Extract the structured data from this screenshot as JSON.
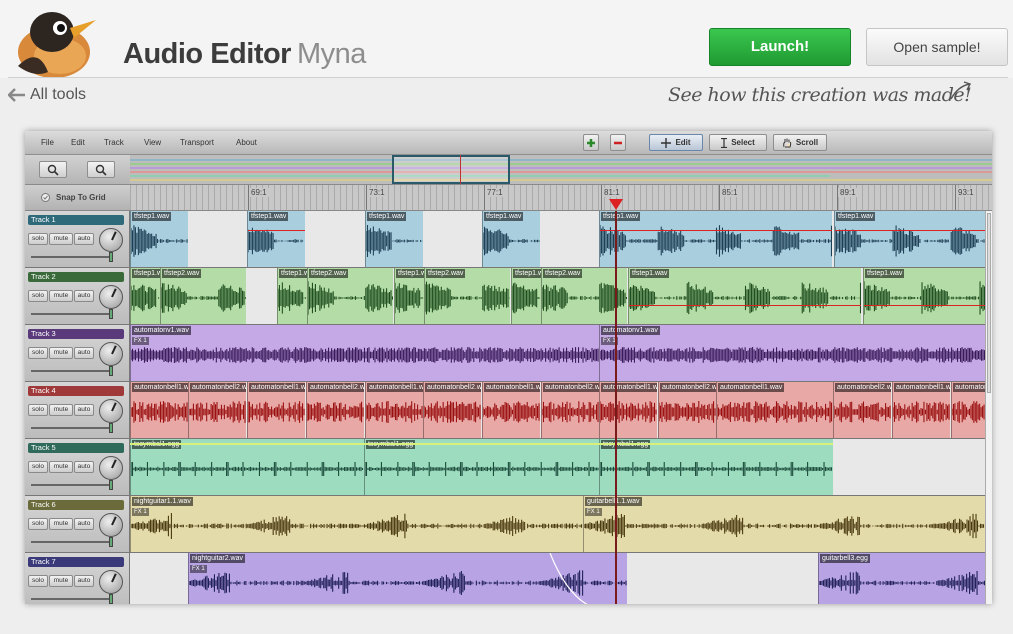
{
  "header": {
    "title": "Audio Editor",
    "subtitle": "Myna",
    "launch_label": "Launch!",
    "open_sample_label": "Open sample!",
    "all_tools_label": "All tools",
    "see_how_label": "See how this creation was made!"
  },
  "editor": {
    "menu": [
      "File",
      "Edit",
      "Track",
      "View",
      "Transport",
      "About"
    ],
    "tools": {
      "edit": "Edit",
      "select": "Select",
      "scroll": "Scroll"
    },
    "snap_label": "Snap To Grid",
    "ruler_labels": [
      "69:1",
      "73:1",
      "77:1",
      "81:1",
      "85:1",
      "89:1",
      "93:1"
    ],
    "track_buttons": {
      "solo": "solo",
      "mute": "mute",
      "auto": "auto"
    },
    "tracks": [
      {
        "name": "Track 1",
        "color": "#2f6a7a",
        "clip_color": "#a9cfdf",
        "wave_color": "#1f3f55",
        "clips": [
          {
            "label": "tfstep1.wav"
          },
          {
            "label": "tfstep1.wav"
          },
          {
            "label": "tfstep1.wav"
          },
          {
            "label": "tfstep1.wav"
          },
          {
            "label": "tfstep1.wav"
          },
          {
            "label": "tfstep1.wav"
          }
        ]
      },
      {
        "name": "Track 2",
        "color": "#3a6a3a",
        "clip_color": "#b4dca6",
        "wave_color": "#1f4f1f",
        "clips": [
          {
            "label": "tfstep1.wav"
          },
          {
            "label": "tfstep2.wav"
          },
          {
            "label": "tfstep1.wav"
          },
          {
            "label": "tfstep2.wav"
          },
          {
            "label": "tfstep1.wav"
          },
          {
            "label": "tfstep2.wav"
          },
          {
            "label": "tfstep1.wav"
          },
          {
            "label": "tfstep2.wav"
          },
          {
            "label": "tfstep1.wav"
          },
          {
            "label": "tfstep1.wav"
          }
        ]
      },
      {
        "name": "Track 3",
        "color": "#5a3a7a",
        "clip_color": "#c5a8e6",
        "wave_color": "#3a1a5a",
        "clips": [
          {
            "label": "automatonv1.wav",
            "fx": "FX 1"
          },
          {
            "label": "automatonv1.wav",
            "fx": "FX 1"
          }
        ]
      },
      {
        "name": "Track 4",
        "color": "#a03a3a",
        "clip_color": "#e8a8a6",
        "wave_color": "#9a1010",
        "clips": [
          {
            "label": "automatonbell1.wav"
          },
          {
            "label": "automatonbell2.wav"
          },
          {
            "label": "automatonbell1.wav"
          },
          {
            "label": "automatonbell2.wav"
          },
          {
            "label": "automatonbell1.wav"
          },
          {
            "label": "automatonbell2.wav"
          },
          {
            "label": "automatonbell1.wav"
          },
          {
            "label": "automatonbell2.wav"
          },
          {
            "label": "automatonbell1.wav"
          },
          {
            "label": "automatonbell2.wav"
          },
          {
            "label": "automatonbell1.wav"
          },
          {
            "label": "automatonbell2.wav"
          },
          {
            "label": "automatonbell1.wav"
          },
          {
            "label": "automatonbell2.wav"
          },
          {
            "label": "automatonbell1.wav"
          }
        ]
      },
      {
        "name": "Track 5",
        "color": "#2f6a5a",
        "clip_color": "#9edcc0",
        "wave_color": "#1a4a3a",
        "clips": [
          {
            "label": "tscymbal1.egg"
          },
          {
            "label": "tscymbal1.egg"
          },
          {
            "label": "tscymbal1.egg"
          }
        ]
      },
      {
        "name": "Track 6",
        "color": "#6a6a3a",
        "clip_color": "#e4dbaa",
        "wave_color": "#4a3a10",
        "clips": [
          {
            "label": "nightguitar1.1.wav",
            "fx": "FX 1"
          },
          {
            "label": "guitarbell1.1.wav",
            "fx": "FX 1"
          }
        ]
      },
      {
        "name": "Track 7",
        "color": "#3a3a7a",
        "clip_color": "#b8a4e4",
        "wave_color": "#20205a",
        "clips": [
          {
            "label": "nightguitar2.wav",
            "fx": "FX 1"
          },
          {
            "label": "guitarbell3.egg"
          }
        ]
      }
    ]
  },
  "colors": {
    "launch": "#2bb140",
    "accent_red": "#d22222"
  },
  "icons": {
    "back": "arrow-left-icon",
    "logo": "robin-bird-logo",
    "edit": "move-cross-icon",
    "select": "i-beam-icon",
    "scroll": "hand-icon"
  }
}
